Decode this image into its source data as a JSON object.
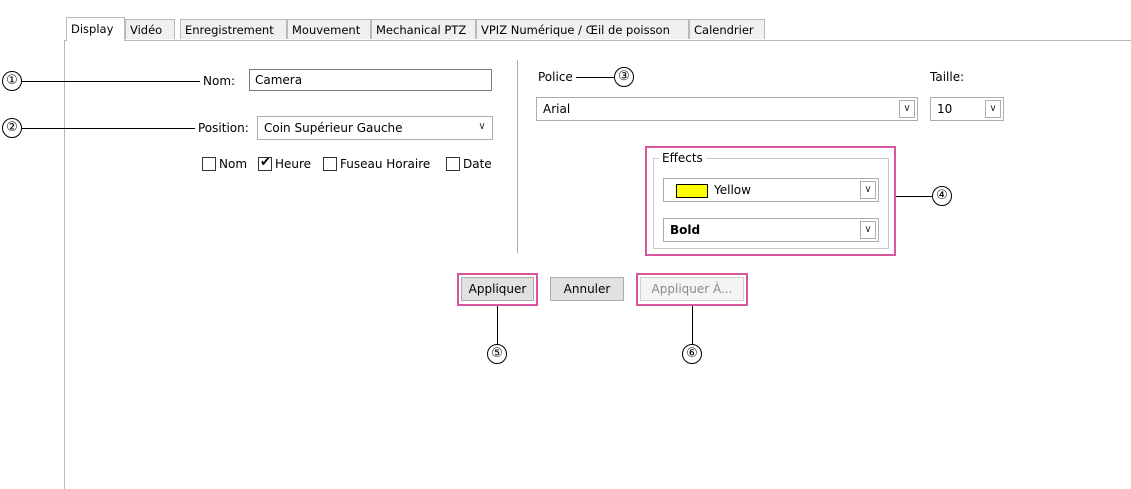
{
  "tabs": [
    "Display",
    "Vidéo",
    "Enregistrement",
    "Mouvement",
    "Mechanical PTZ",
    "VPIZ Numérique / Œil de poisson",
    "Calendrier"
  ],
  "form": {
    "name_label": "Nom:",
    "name_value": "Camera",
    "position_label": "Position:",
    "position_value": "Coin Supérieur Gauche",
    "checkboxes": [
      {
        "label": "Nom",
        "checked": false
      },
      {
        "label": "Heure",
        "checked": true
      },
      {
        "label": "Fuseau Horaire",
        "checked": false
      },
      {
        "label": "Date",
        "checked": false
      }
    ]
  },
  "font": {
    "police_label": "Police",
    "police_value": "Arial",
    "taille_label": "Taille:",
    "taille_value": "10"
  },
  "effects": {
    "legend": "Effects",
    "color_value": "Yellow",
    "color_hex": "#ffff00",
    "style_value": "Bold"
  },
  "buttons": {
    "apply": "Appliquer",
    "cancel": "Annuler",
    "apply_to": "Appliquer À..."
  },
  "callouts": [
    "①",
    "②",
    "③",
    "④",
    "⑤",
    "⑥"
  ],
  "colors": {
    "highlight": "#d8569d"
  }
}
